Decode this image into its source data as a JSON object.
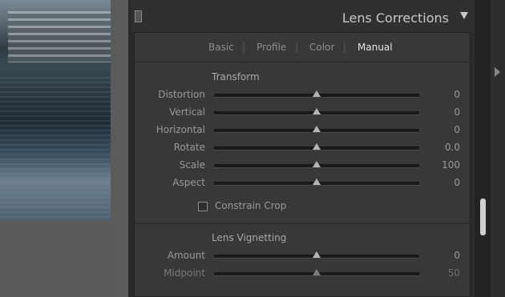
{
  "panel": {
    "title": "Lens Corrections",
    "tabs": [
      {
        "label": "Basic",
        "active": false
      },
      {
        "label": "Profile",
        "active": false
      },
      {
        "label": "Color",
        "active": false
      },
      {
        "label": "Manual",
        "active": true
      }
    ]
  },
  "transform": {
    "title": "Transform",
    "sliders": [
      {
        "label": "Distortion",
        "value": "0"
      },
      {
        "label": "Vertical",
        "value": "0"
      },
      {
        "label": "Horizontal",
        "value": "0"
      },
      {
        "label": "Rotate",
        "value": "0.0"
      },
      {
        "label": "Scale",
        "value": "100"
      },
      {
        "label": "Aspect",
        "value": "0"
      }
    ],
    "constrain_crop": {
      "label": "Constrain Crop",
      "checked": false
    }
  },
  "vignetting": {
    "title": "Lens Vignetting",
    "sliders": [
      {
        "label": "Amount",
        "value": "0"
      },
      {
        "label": "Midpoint",
        "value": "50"
      }
    ]
  },
  "icons": {
    "collapse": "triangle-down-icon",
    "panel_toggle": "panel-toggle-icon",
    "right_panel": "triangle-right-icon"
  }
}
